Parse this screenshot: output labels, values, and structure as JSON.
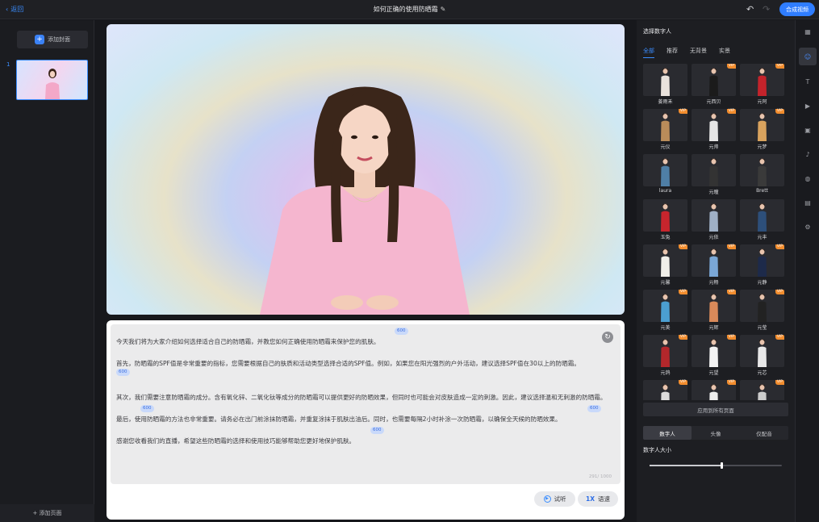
{
  "header": {
    "back_label": "返回",
    "title": "如何正确的使用防晒霜",
    "compose_label": "合成视频"
  },
  "left_panel": {
    "add_cover_label": "添加封面",
    "page_number": "1",
    "add_page_label": "+ 添加页面"
  },
  "script": {
    "paragraphs": [
      "今天我们将为大家介绍如何选择适合自己的防晒霜，并教您如何正确使用防晒霜来保护您的肌肤。",
      "首先，防晒霜的SPF值是非常重要的指标，您需要根据自己的肤质和活动类型选择合适的SPF值。例如，如果您在阳光强烈的户外活动，建议选择SPF值在30以上的防晒霜。",
      "其次，我们需要注意防晒霜的成分。含有氧化锌、二氧化钛等成分的防晒霜可以提供更好的防晒效果，但同时也可能会对皮肤造成一定的刺激。因此，建议选择温和无刺激的防晒霜。",
      "最后，使用防晒霜的方法也非常重要。请务必在出门前涂抹防晒霜，并重复涂抹于肌肤出油后。同时，也需要每隔2小时补涂一次防晒霜，以确保全天候的防晒效果。",
      "感谢您收看我们的直播，希望这些防晒霜的选择和使用技巧能够帮助您更好地保护肌肤。"
    ],
    "pause_badge": "600",
    "char_count": "291/ 1000",
    "listen_label": "试听",
    "speed_value": "1X",
    "speed_label": "语速"
  },
  "right_panel": {
    "title": "选择数字人",
    "tabs": [
      "全部",
      "推荐",
      "无背景",
      "实景"
    ],
    "avatars": [
      {
        "name": "姜雨禾",
        "vip": false,
        "outfit": "#e9e2dc"
      },
      {
        "name": "元西贝",
        "vip": true,
        "outfit": "#1b1b1b"
      },
      {
        "name": "元阿",
        "vip": true,
        "outfit": "#c4232b"
      },
      {
        "name": "元仪",
        "vip": true,
        "outfit": "#b98c5a"
      },
      {
        "name": "元帅",
        "vip": true,
        "outfit": "#e5e5e5"
      },
      {
        "name": "元梦",
        "vip": true,
        "outfit": "#d9a35e"
      },
      {
        "name": "laura",
        "vip": false,
        "outfit": "#4f7fa6"
      },
      {
        "name": "元瞳",
        "vip": false,
        "outfit": "#333333"
      },
      {
        "name": "Brett",
        "vip": false,
        "outfit": "#3a3a3a"
      },
      {
        "name": "玉兔",
        "vip": false,
        "outfit": "#c7252d"
      },
      {
        "name": "元依",
        "vip": false,
        "outfit": "#9fb0c6"
      },
      {
        "name": "元丰",
        "vip": false,
        "outfit": "#2d4f7a"
      },
      {
        "name": "元馨",
        "vip": true,
        "outfit": "#f0eee8"
      },
      {
        "name": "元畅",
        "vip": true,
        "outfit": "#7aa7d6"
      },
      {
        "name": "元静",
        "vip": true,
        "outfit": "#1d2a4a"
      },
      {
        "name": "元美",
        "vip": true,
        "outfit": "#4b9fd1"
      },
      {
        "name": "元辉",
        "vip": true,
        "outfit": "#d98a5a"
      },
      {
        "name": "元莹",
        "vip": true,
        "outfit": "#222222"
      },
      {
        "name": "元鸽",
        "vip": true,
        "outfit": "#b3272b"
      },
      {
        "name": "元望",
        "vip": true,
        "outfit": "#f2f2f2"
      },
      {
        "name": "元芯",
        "vip": true,
        "outfit": "#e8e8e8"
      },
      {
        "name": "",
        "vip": true,
        "outfit": "#dcdcdc"
      },
      {
        "name": "",
        "vip": true,
        "outfit": "#eeeeee"
      },
      {
        "name": "",
        "vip": true,
        "outfit": "#cccccc"
      }
    ],
    "vip_badge": "VIP",
    "apply_all_label": "应用到所有页面",
    "segments": [
      "数字人",
      "头像",
      "仅配音"
    ],
    "size_label": "数字人大小",
    "size_value": 0.54
  },
  "colors": {
    "accent": "#2f7dff",
    "vip": "#f28d2e"
  },
  "icons": [
    "back-chevron-icon",
    "edit-pencil-icon",
    "undo-icon",
    "redo-icon",
    "refresh-icon",
    "play-circle-icon",
    "layout-icon",
    "avatar-icon",
    "text-icon",
    "video-icon",
    "background-icon",
    "music-icon",
    "sticker-icon",
    "subtitle-icon",
    "gear-icon"
  ]
}
